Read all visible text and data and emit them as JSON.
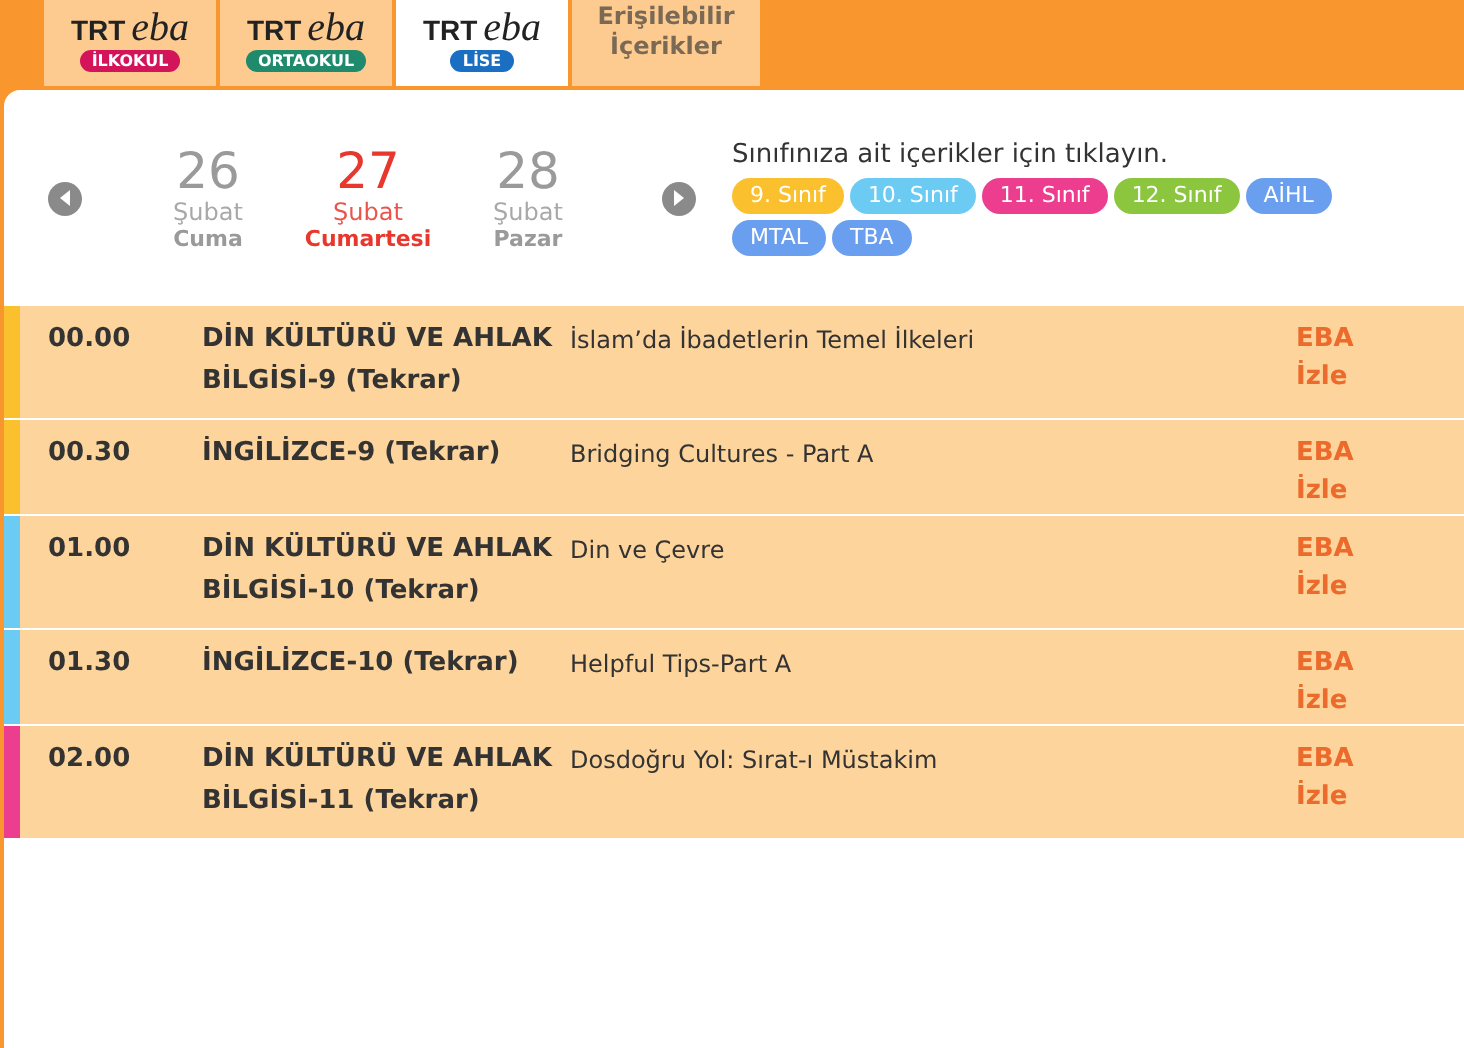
{
  "tabs": [
    {
      "kind": "logo",
      "brand": "TRT",
      "logo": "eba",
      "badge": "İLKOKUL",
      "color": "#d4145a",
      "selected": false
    },
    {
      "kind": "logo",
      "brand": "TRT",
      "logo": "eba",
      "badge": "ORTAOKUL",
      "color": "#1f8a6c",
      "selected": false
    },
    {
      "kind": "logo",
      "brand": "TRT",
      "logo": "eba",
      "badge": "LİSE",
      "color": "#1b6fc2",
      "selected": true
    },
    {
      "kind": "text",
      "lines": [
        "Erişilebilir",
        "İçerikler"
      ],
      "selected": false
    }
  ],
  "days": [
    {
      "day": "26",
      "month": "Şubat",
      "weekday": "Cuma",
      "selected": false
    },
    {
      "day": "27",
      "month": "Şubat",
      "weekday": "Cumartesi",
      "selected": true
    },
    {
      "day": "28",
      "month": "Şubat",
      "weekday": "Pazar",
      "selected": false
    }
  ],
  "class_prompt": "Sınıfınıza ait içerikler için tıklayın.",
  "class_tags": [
    {
      "label": "9. Sınıf",
      "color": "#fbc02d"
    },
    {
      "label": "10. Sınıf",
      "color": "#6ccbf3"
    },
    {
      "label": "11. Sınıf",
      "color": "#ec3d8f"
    },
    {
      "label": "12. Sınıf",
      "color": "#8cc63f"
    },
    {
      "label": "AİHL",
      "color": "#6a9ff0"
    },
    {
      "label": "MTAL",
      "color": "#6a9ff0"
    },
    {
      "label": "TBA",
      "color": "#6a9ff0"
    }
  ],
  "schedule": [
    {
      "time": "00.00",
      "lesson": "DİN KÜLTÜRÜ VE AHLAK BİLGİSİ-9 (Tekrar)",
      "topic": "İslam’da İbadetlerin Temel İlkeleri",
      "links": [
        "EBA",
        "İzle"
      ],
      "color": "#fbc02d"
    },
    {
      "time": "00.30",
      "lesson": "İNGİLİZCE-9 (Tekrar)",
      "topic": "Bridging Cultures - Part A",
      "links": [
        "EBA",
        "İzle"
      ],
      "color": "#fbc02d"
    },
    {
      "time": "01.00",
      "lesson": "DİN KÜLTÜRÜ VE AHLAK BİLGİSİ-10 (Tekrar)",
      "topic": "Din ve Çevre",
      "links": [
        "EBA",
        "İzle"
      ],
      "color": "#6ccbf3"
    },
    {
      "time": "01.30",
      "lesson": "İNGİLİZCE-10 (Tekrar)",
      "topic": "Helpful Tips-Part A",
      "links": [
        "EBA",
        "İzle"
      ],
      "color": "#6ccbf3"
    },
    {
      "time": "02.00",
      "lesson": "DİN KÜLTÜRÜ VE AHLAK BİLGİSİ-11 (Tekrar)",
      "topic": "Dosdoğru Yol: Sırat-ı Müstakim",
      "links": [
        "EBA",
        "İzle"
      ],
      "color": "#ec3d8f"
    }
  ]
}
